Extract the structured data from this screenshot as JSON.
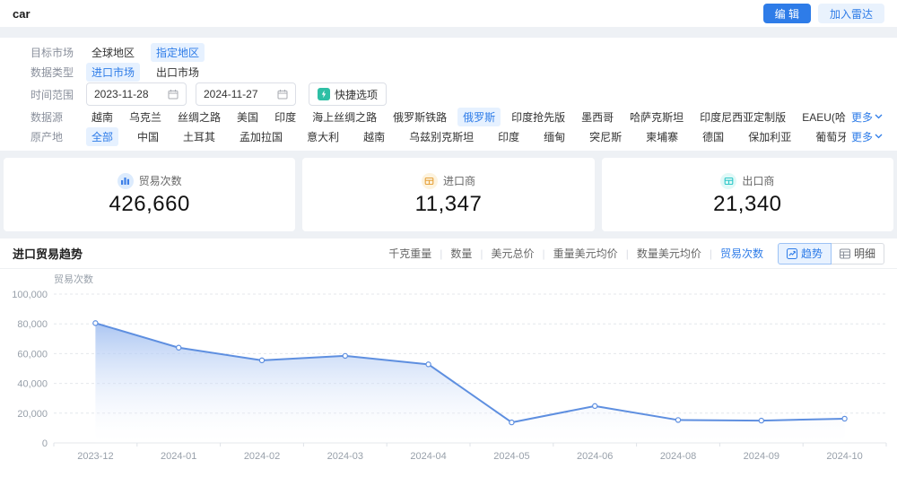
{
  "header": {
    "title": "car",
    "edit_button": "编 辑",
    "add_radar_button": "加入雷达"
  },
  "filters": {
    "target": {
      "label": "目标市场",
      "options": [
        {
          "text": "全球地区",
          "selected": false
        },
        {
          "text": "指定地区",
          "selected": true
        }
      ]
    },
    "datatype": {
      "label": "数据类型",
      "options": [
        {
          "text": "进口市场",
          "selected": true
        },
        {
          "text": "出口市场",
          "selected": false
        }
      ]
    },
    "time": {
      "label": "时间范围",
      "start": "2023-11-28",
      "end": "2024-11-27",
      "quick_button": "快捷选项"
    },
    "source": {
      "label": "数据源",
      "more": "更多",
      "options": [
        {
          "text": "越南",
          "selected": false
        },
        {
          "text": "乌克兰",
          "selected": false
        },
        {
          "text": "丝绸之路",
          "selected": false
        },
        {
          "text": "美国",
          "selected": false
        },
        {
          "text": "印度",
          "selected": false
        },
        {
          "text": "海上丝绸之路",
          "selected": false
        },
        {
          "text": "俄罗斯铁路",
          "selected": false
        },
        {
          "text": "俄罗斯",
          "selected": true
        },
        {
          "text": "印度抢先版",
          "selected": false
        },
        {
          "text": "墨西哥",
          "selected": false
        },
        {
          "text": "哈萨克斯坦",
          "selected": false
        },
        {
          "text": "印度尼西亚定制版",
          "selected": false
        },
        {
          "text": "EAEU(哈萨克斯坦)",
          "selected": false
        }
      ]
    },
    "origin": {
      "label": "原产地",
      "more": "更多",
      "options": [
        {
          "text": "全部",
          "selected": true
        },
        {
          "text": "中国",
          "selected": false
        },
        {
          "text": "土耳其",
          "selected": false
        },
        {
          "text": "孟加拉国",
          "selected": false
        },
        {
          "text": "意大利",
          "selected": false
        },
        {
          "text": "越南",
          "selected": false
        },
        {
          "text": "乌兹别克斯坦",
          "selected": false
        },
        {
          "text": "印度",
          "selected": false
        },
        {
          "text": "缅甸",
          "selected": false
        },
        {
          "text": "突尼斯",
          "selected": false
        },
        {
          "text": "柬埔寨",
          "selected": false
        },
        {
          "text": "德国",
          "selected": false
        },
        {
          "text": "保加利亚",
          "selected": false
        },
        {
          "text": "葡萄牙",
          "selected": false
        }
      ]
    }
  },
  "stats": [
    {
      "icon": "bar-chart-icon",
      "label": "贸易次数",
      "value": "426,660",
      "accent": "#3d7fe8",
      "bg": "#dcebfd"
    },
    {
      "icon": "importer-icon",
      "label": "进口商",
      "value": "11,347",
      "accent": "#e6a23c",
      "bg": "#fdf3de"
    },
    {
      "icon": "exporter-icon",
      "label": "出口商",
      "value": "21,340",
      "accent": "#2ec7c9",
      "bg": "#e0f9f7"
    }
  ],
  "chart_section": {
    "title": "进口贸易趋势",
    "metric_tabs": [
      {
        "label": "千克重量",
        "selected": false
      },
      {
        "label": "数量",
        "selected": false
      },
      {
        "label": "美元总价",
        "selected": false
      },
      {
        "label": "重量美元均价",
        "selected": false
      },
      {
        "label": "数量美元均价",
        "selected": false
      },
      {
        "label": "贸易次数",
        "selected": true
      }
    ],
    "view_buttons": [
      {
        "label": "趋势",
        "icon": "trend-icon",
        "selected": true
      },
      {
        "label": "明细",
        "icon": "detail-icon",
        "selected": false
      }
    ]
  },
  "chart_data": {
    "type": "area",
    "title": "进口贸易趋势",
    "ylabel": "贸易次数",
    "xlabel": "",
    "categories": [
      "2023-12",
      "2024-01",
      "2024-02",
      "2024-03",
      "2024-04",
      "2024-05",
      "2024-06",
      "2024-08",
      "2024-09",
      "2024-10"
    ],
    "values": [
      80500,
      64000,
      55500,
      58500,
      52800,
      13800,
      24800,
      15400,
      15000,
      16300
    ],
    "ylim": [
      0,
      100000
    ],
    "ytick_step": 20000,
    "grid": true,
    "legend": "none",
    "line_color": "#5e8fe0",
    "area_top_color": "#9dbcf0",
    "area_bottom_color": "#ffffff"
  }
}
